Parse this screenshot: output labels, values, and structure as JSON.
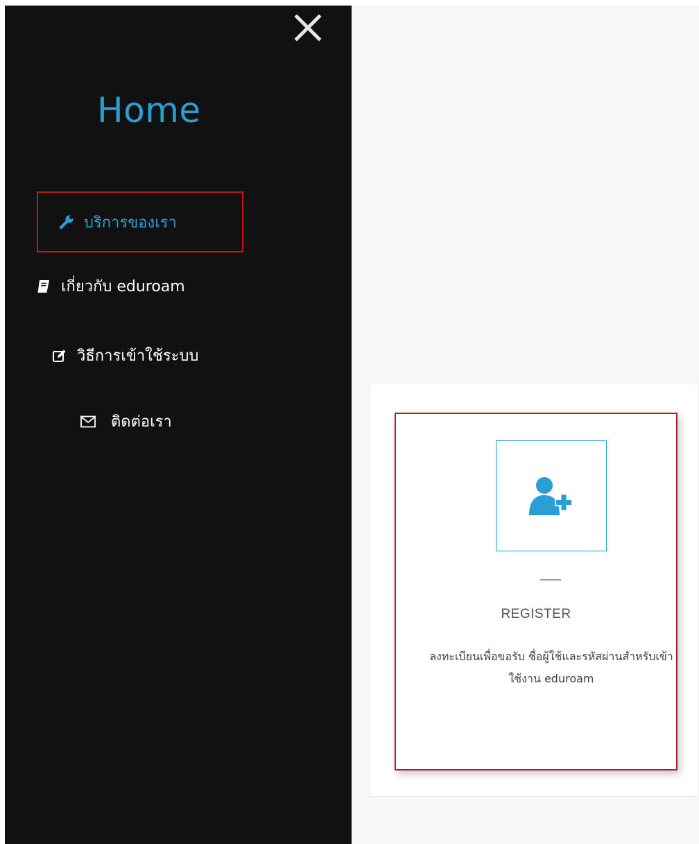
{
  "sidebar": {
    "title": "Home",
    "close_icon": "close-icon",
    "items": [
      {
        "label": "บริการของเรา",
        "icon": "wrench-icon",
        "active": true
      },
      {
        "label": "เกี่ยวกับ eduroam",
        "icon": "book-icon",
        "active": false
      },
      {
        "label": "วิธีการเข้าใช้ระบบ",
        "icon": "edit-icon",
        "active": false
      },
      {
        "label": "ติดต่อเรา",
        "icon": "envelope-icon",
        "active": false
      }
    ]
  },
  "register_card": {
    "icon": "user-add-icon",
    "title": "REGISTER",
    "description": "ลงทะเบียนเพื่อขอรับ ชื่อผู้ใช้และรหัสผ่านสำหรับเข้าใช้งาน eduroam"
  },
  "colors": {
    "accent": "#2a9fd6",
    "sidebar_bg": "#111111",
    "highlight_border": "#c4161c",
    "content_bg": "#f7f7f7"
  }
}
